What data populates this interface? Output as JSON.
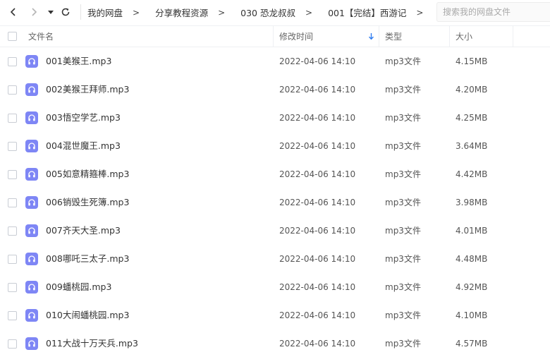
{
  "nav": {
    "back_icon": "chevron-left-icon",
    "forward_icon": "chevron-right-icon",
    "history_icon": "caret-down-icon",
    "refresh_icon": "refresh-icon"
  },
  "breadcrumb": [
    "我的网盘",
    "分享教程资源",
    "030 恐龙叔叔",
    "001【完结】西游记"
  ],
  "breadcrumb_separator": ">",
  "search": {
    "placeholder": "搜索我的网盘文件"
  },
  "columns": {
    "name": "文件名",
    "modified": "修改时间",
    "type": "类型",
    "size": "大小"
  },
  "sort": {
    "column": "modified",
    "direction": "descending",
    "icon": "arrow-down-icon"
  },
  "colors": {
    "audio_icon": "#7e86f5",
    "sort_arrow": "#2e7cf0"
  },
  "files": [
    {
      "name": "001美猴王.mp3",
      "modified": "2022-04-06 14:10",
      "type": "mp3文件",
      "size": "4.15MB"
    },
    {
      "name": "002美猴王拜师.mp3",
      "modified": "2022-04-06 14:10",
      "type": "mp3文件",
      "size": "4.20MB"
    },
    {
      "name": "003悟空学艺.mp3",
      "modified": "2022-04-06 14:10",
      "type": "mp3文件",
      "size": "4.25MB"
    },
    {
      "name": "004混世魔王.mp3",
      "modified": "2022-04-06 14:10",
      "type": "mp3文件",
      "size": "3.64MB"
    },
    {
      "name": "005如意精箍棒.mp3",
      "modified": "2022-04-06 14:10",
      "type": "mp3文件",
      "size": "4.42MB"
    },
    {
      "name": "006销毁生死簿.mp3",
      "modified": "2022-04-06 14:10",
      "type": "mp3文件",
      "size": "3.98MB"
    },
    {
      "name": "007齐天大圣.mp3",
      "modified": "2022-04-06 14:10",
      "type": "mp3文件",
      "size": "4.01MB"
    },
    {
      "name": "008哪吒三太子.mp3",
      "modified": "2022-04-06 14:10",
      "type": "mp3文件",
      "size": "4.48MB"
    },
    {
      "name": "009蟠桃园.mp3",
      "modified": "2022-04-06 14:10",
      "type": "mp3文件",
      "size": "4.92MB"
    },
    {
      "name": "010大闹蟠桃园.mp3",
      "modified": "2022-04-06 14:10",
      "type": "mp3文件",
      "size": "4.10MB"
    },
    {
      "name": "011大战十万天兵.mp3",
      "modified": "2022-04-06 14:10",
      "type": "mp3文件",
      "size": "4.57MB"
    }
  ]
}
